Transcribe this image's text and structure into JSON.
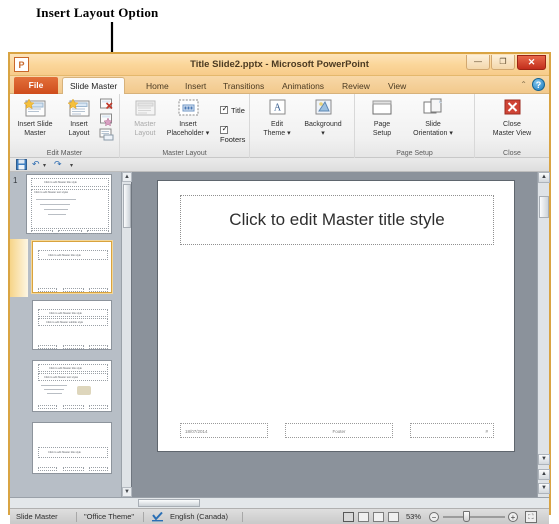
{
  "annotation": {
    "label": "Insert Layout Option",
    "arrow_icon": "down-arrow-annotation"
  },
  "window": {
    "logo": "P",
    "title": "Title Slide2.pptx  -  Microsoft PowerPoint",
    "controls": {
      "minimize": "—",
      "maximize": "❐",
      "close": "✕"
    }
  },
  "quick_access": {
    "save": "💾",
    "undo": "↶",
    "undo_arrow": "▾",
    "redo": "↷",
    "customize": "▾"
  },
  "ribbon": {
    "file_tab": "File",
    "tabs": [
      {
        "label": "Slide Master",
        "active": true
      },
      {
        "label": "Home",
        "active": false
      },
      {
        "label": "Insert",
        "active": false
      },
      {
        "label": "Transitions",
        "active": false
      },
      {
        "label": "Animations",
        "active": false
      },
      {
        "label": "Review",
        "active": false
      },
      {
        "label": "View",
        "active": false
      }
    ],
    "collapse_icon": "⌃",
    "help_icon": "?",
    "groups": [
      {
        "name": "Edit Master",
        "commands": [
          {
            "label_line1": "Insert Slide",
            "label_line2": "Master",
            "icon": "insert-slide-master-icon",
            "disabled": false
          },
          {
            "label_line1": "Insert",
            "label_line2": "Layout",
            "icon": "insert-layout-icon",
            "disabled": false
          }
        ],
        "small_commands": [
          {
            "name": "delete-master-icon"
          },
          {
            "name": "preserve-master-icon"
          },
          {
            "name": "rename-master-icon"
          }
        ]
      },
      {
        "name": "Master Layout",
        "commands": [
          {
            "label_line1": "Master",
            "label_line2": "Layout",
            "icon": "master-layout-icon",
            "disabled": true
          },
          {
            "label_line1": "Insert",
            "label_line2": "Placeholder ▾",
            "icon": "insert-placeholder-icon",
            "disabled": false
          }
        ],
        "checkboxes": [
          {
            "label": "Title",
            "checked": true
          },
          {
            "label": "Footers",
            "checked": true
          }
        ]
      },
      {
        "name": "",
        "commands": [
          {
            "label_line1": "Edit",
            "label_line2": "Theme ▾",
            "icon": "edit-theme-icon",
            "disabled": false
          },
          {
            "label_line1": "Background",
            "label_line2": "▾",
            "icon": "background-icon",
            "disabled": false
          }
        ]
      },
      {
        "name": "Page Setup",
        "commands": [
          {
            "label_line1": "Page",
            "label_line2": "Setup",
            "icon": "page-setup-icon",
            "disabled": false
          },
          {
            "label_line1": "Slide",
            "label_line2": "Orientation ▾",
            "icon": "slide-orientation-icon",
            "disabled": false
          }
        ]
      },
      {
        "name": "Close",
        "commands": [
          {
            "label_line1": "Close",
            "label_line2": "Master View",
            "icon": "close-master-view-icon",
            "disabled": false
          }
        ]
      }
    ]
  },
  "thumbnails": {
    "items": [
      {
        "number": "1",
        "title": "Click to edit Master title style",
        "subtitle": "Click to edit Master text styles",
        "selected": false,
        "type": "master"
      },
      {
        "number": "",
        "title": "Click to edit Master title style",
        "subtitle": "",
        "selected": true,
        "type": "title-layout"
      },
      {
        "number": "",
        "title": "Click to edit Master title style",
        "subtitle": "Click to edit Master subtitle style",
        "selected": false,
        "type": "title-content-layout"
      },
      {
        "number": "",
        "title": "Click to edit Master title style",
        "subtitle": "Click to edit Master text styles",
        "selected": false,
        "type": "content-layout"
      },
      {
        "number": "",
        "title": "Click to edit Master title style",
        "subtitle": "",
        "selected": false,
        "type": "section-layout"
      }
    ],
    "scrollbar": {
      "up": "▲",
      "down": "▼"
    }
  },
  "slide": {
    "title_placeholder": "Click to edit Master title style",
    "footer_date": "18/07/2014",
    "footer_text": "Footer",
    "footer_number": "#"
  },
  "main_scrollbar": {
    "up": "▲",
    "down": "▼",
    "prev_slide": "▲",
    "next_slide": "▼"
  },
  "status_bar": {
    "view_name": "Slide Master",
    "theme_name": "\"Office Theme\"",
    "spell_icon": "spell-check-icon",
    "language": "English (Canada)",
    "view_buttons": [
      {
        "name": "normal-view-button",
        "active": true
      },
      {
        "name": "slide-sorter-view-button",
        "active": false
      },
      {
        "name": "reading-view-button",
        "active": false
      },
      {
        "name": "slideshow-view-button",
        "active": false
      }
    ],
    "zoom_level": "53%",
    "zoom_out": "−",
    "zoom_in": "+",
    "fit_window": "⛶"
  },
  "colors": {
    "window_border": "#d9a443",
    "file_tab": "#cf4c1c",
    "close_button": "#c22e1c",
    "selection_highlight": "#f6d488",
    "workspace": "#878f99"
  }
}
